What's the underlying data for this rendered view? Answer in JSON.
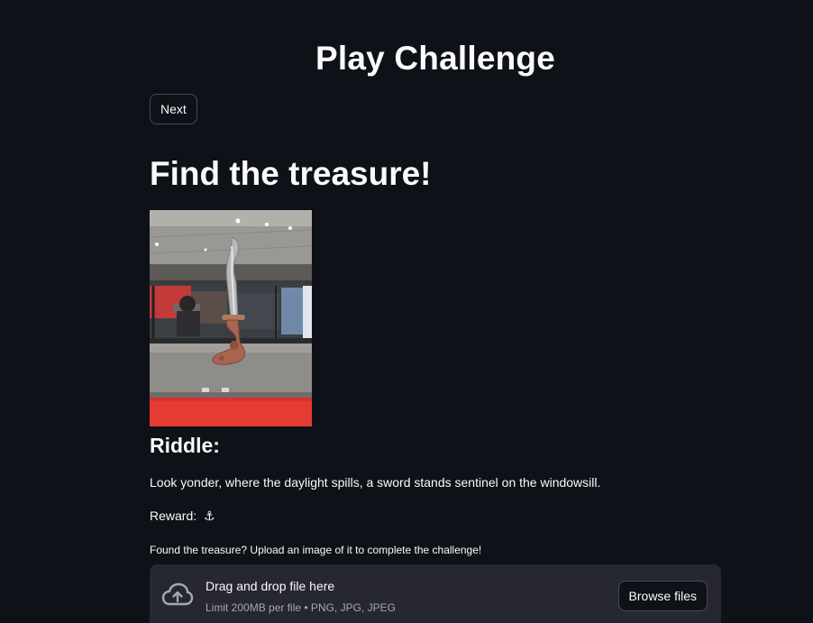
{
  "page": {
    "title": "Play Challenge",
    "next_label": "Next"
  },
  "challenge": {
    "title": "Find the treasure!",
    "image_icon": "photo-of-inflatable-sword-on-windowsill",
    "riddle_heading": "Riddle:",
    "riddle_text": "Look yonder, where the daylight spills, a sword stands sentinel on the windowsill.",
    "reward_label": "Reward:",
    "reward_value": "⚓"
  },
  "upload": {
    "label": "Found the treasure? Upload an image of it to complete the challenge!",
    "drop_title": "Drag and drop file here",
    "limit_text": "Limit 200MB per file • PNG, JPG, JPEG",
    "browse_label": "Browse files",
    "icon": "cloud-upload-icon"
  },
  "colors": {
    "background": "#0e1117",
    "dropzone": "#262730",
    "text": "#fafafa",
    "muted_text": "#a3a8b4"
  }
}
